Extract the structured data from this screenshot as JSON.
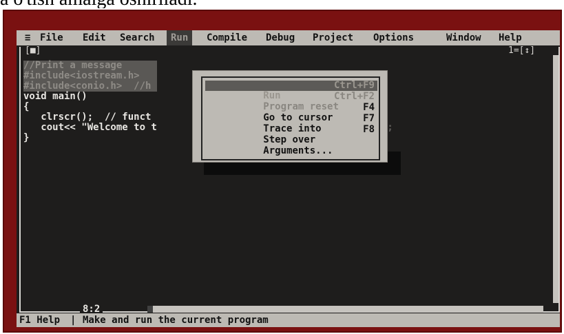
{
  "caption": "a o'tish amalga oshiriladi.",
  "menubar": {
    "system": "≡",
    "items": [
      "File",
      "Edit",
      "Search",
      "Run",
      "Compile",
      "Debug",
      "Project",
      "Options",
      "Window",
      "Help"
    ],
    "active": "Run"
  },
  "editor": {
    "close_box": "[■]",
    "window_number": "1=[↕]",
    "lines": [
      "//Print a message",
      "#include<iostream.h>",
      "#include<conio.h>  //h",
      "void main()",
      "{",
      "   clrscr();  // funct",
      "   cout<< \"Welcome to t",
      "}"
    ],
    "line_tail": "\";",
    "cursor_position": "8:2"
  },
  "run_menu": {
    "items": [
      {
        "label": "Run",
        "shortcut": "Ctrl+F9",
        "state": "selected"
      },
      {
        "label": "Program reset",
        "shortcut": "Ctrl+F2",
        "state": "disabled"
      },
      {
        "label": "Go to cursor",
        "shortcut": "F4",
        "state": "normal"
      },
      {
        "label": "Trace into",
        "shortcut": "F7",
        "state": "normal"
      },
      {
        "label": "Step over",
        "shortcut": "F8",
        "state": "normal"
      },
      {
        "label": "Arguments...",
        "shortcut": "",
        "state": "normal"
      }
    ]
  },
  "status": {
    "help_key": "F1 Help",
    "message": "Make and run the current program"
  },
  "colors": {
    "frame": "#7a1111",
    "desktop": "#1e1d1c",
    "menubar": "#bdbab4"
  }
}
